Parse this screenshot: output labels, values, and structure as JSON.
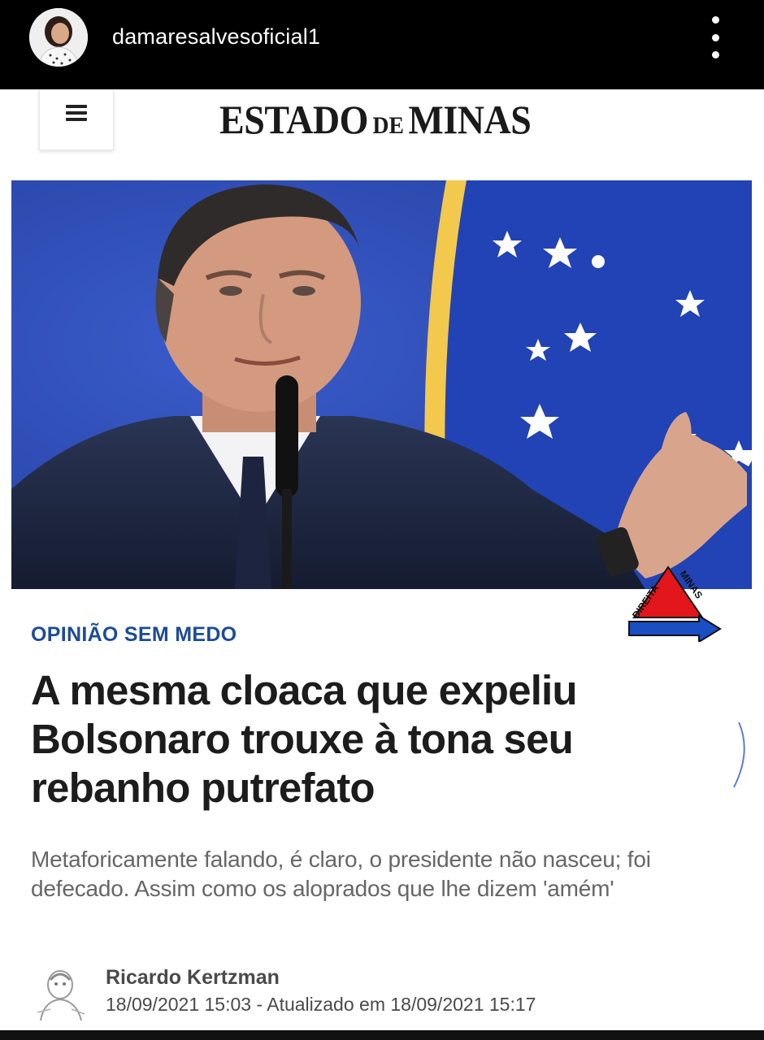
{
  "instagram": {
    "username": "damaresalvesoficial1",
    "more_options_icon": "more-vertical-icon"
  },
  "site": {
    "logo_left": "ESTADO",
    "logo_mid": "DE",
    "logo_right": "MINAS",
    "menu_icon": "hamburger-menu-icon"
  },
  "hero": {
    "watermark_top_left": "DIREITA",
    "watermark_top_right": "MINAS"
  },
  "article": {
    "kicker": "OPINIÃO SEM MEDO",
    "headline": "A mesma cloaca que expeliu Bolsonaro trouxe à tona seu rebanho putrefato",
    "subhead": "Metaforicamente falando, é claro, o presidente não nasceu; foi defecado. Assim como os aloprados que lhe dizem 'amém'",
    "author": "Ricardo Kertzman",
    "date": "18/09/2021 15:03 - Atualizado em 18/09/2021 15:17"
  },
  "colors": {
    "kicker": "#1d4b96",
    "flag_blue": "#2b48b0",
    "flag_yellow": "#f2c94c",
    "logo_red": "#e3161b",
    "logo_blue": "#1a4fc4"
  }
}
